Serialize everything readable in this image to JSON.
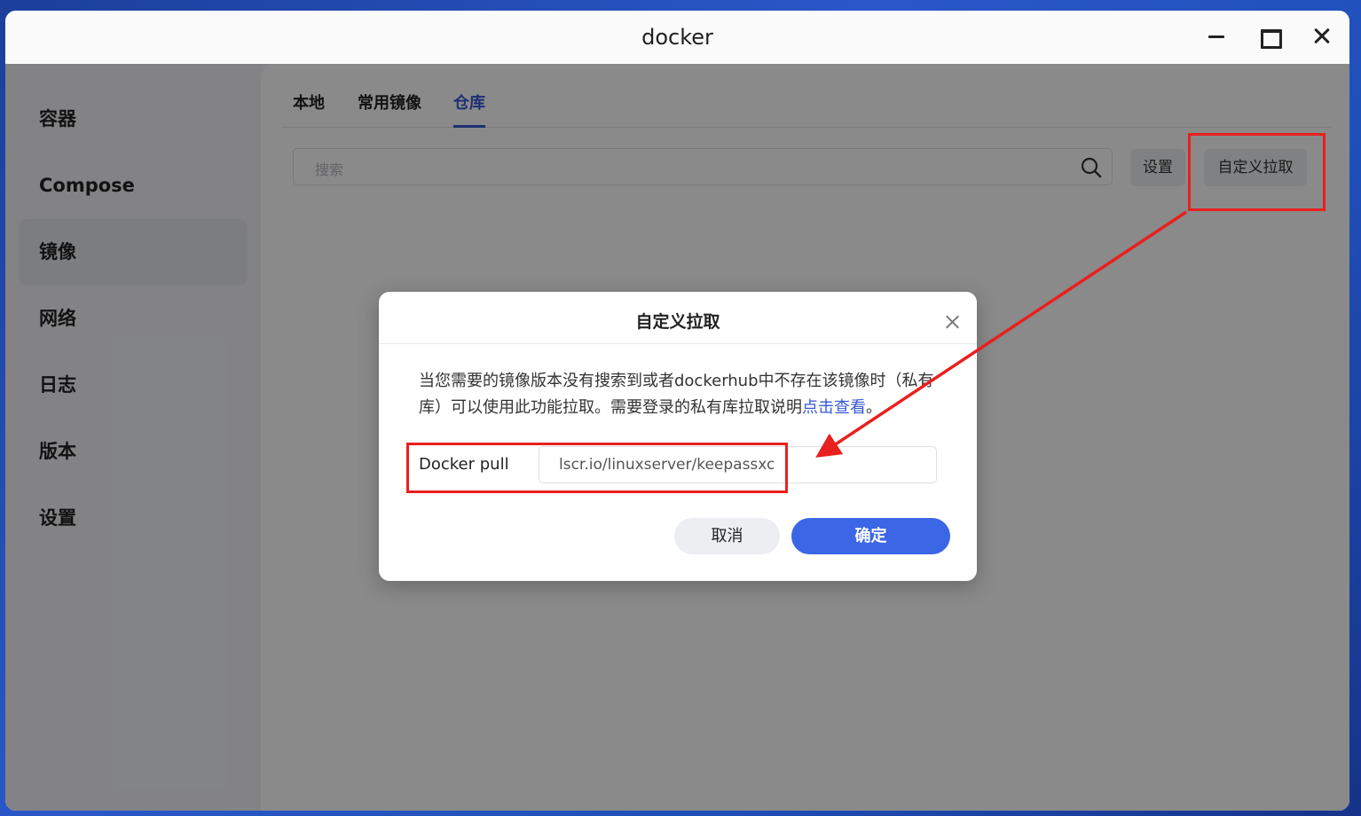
{
  "window": {
    "title": "docker"
  },
  "sidebar": {
    "items": [
      {
        "label": "容器"
      },
      {
        "label": "Compose"
      },
      {
        "label": "镜像",
        "active": true
      },
      {
        "label": "网络"
      },
      {
        "label": "日志"
      },
      {
        "label": "版本"
      },
      {
        "label": "设置"
      }
    ]
  },
  "tabs": [
    {
      "label": "本地"
    },
    {
      "label": "常用镜像"
    },
    {
      "label": "仓库",
      "active": true
    }
  ],
  "search": {
    "placeholder": "搜索"
  },
  "toolbar": {
    "settings_label": "设置",
    "custom_pull_label": "自定义拉取"
  },
  "dialog": {
    "title": "自定义拉取",
    "description": "当您需要的镜像版本没有搜索到或者dockerhub中不存在该镜像时（私有库）可以使用此功能拉取。需要登录的私有库拉取说明",
    "link_text": "点击查看",
    "description_end": "。",
    "pull_label": "Docker pull",
    "pull_value": "lscr.io/linuxserver/keepassxc",
    "cancel_label": "取消",
    "ok_label": "确定"
  },
  "colors": {
    "accent": "#3758d6",
    "primary_button": "#3b66e6",
    "annotation": "#e8201f"
  }
}
